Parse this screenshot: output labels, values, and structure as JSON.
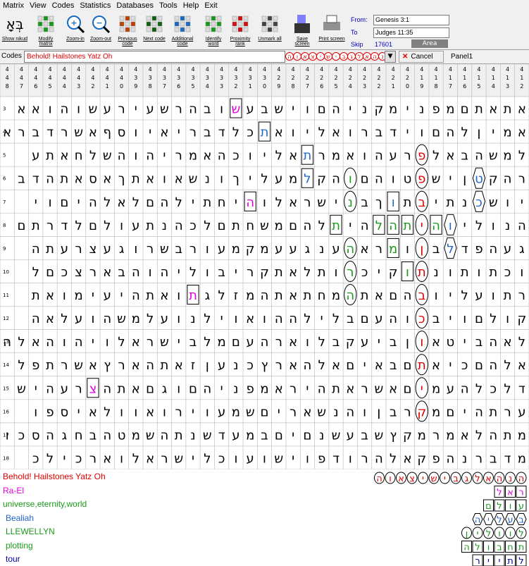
{
  "menu": [
    "Matrix",
    "View",
    "Codes",
    "Statistics",
    "Databases",
    "Tools",
    "Help",
    "Exit"
  ],
  "toolbar": [
    {
      "name": "show-nikud",
      "label": "Show nikud",
      "icon": "nikud-icon"
    },
    {
      "name": "modify-matrix",
      "label": "Modify matrix",
      "icon": "matrix-icon"
    },
    {
      "name": "zoom-in",
      "label": "Zoom-in",
      "icon": "zoom-in-icon"
    },
    {
      "name": "zoom-out",
      "label": "Zoom-out",
      "icon": "zoom-out-icon"
    },
    {
      "name": "previous-code",
      "label": "Previous code",
      "icon": "previous-icon"
    },
    {
      "name": "next-code",
      "label": "Next code",
      "icon": "next-icon"
    },
    {
      "name": "additional-code",
      "label": "Additional code",
      "icon": "additional-icon"
    },
    {
      "name": "identify-word",
      "label": "Identify word",
      "icon": "identify-icon"
    },
    {
      "name": "proximity-rank",
      "label": "Proximity rank",
      "icon": "proximity-icon"
    },
    {
      "name": "unmark-all",
      "label": "Unmark all",
      "icon": "unmark-icon"
    },
    {
      "name": "save-screen",
      "label": "Save screen",
      "icon": "save-icon"
    },
    {
      "name": "print-screen",
      "label": "Print screen",
      "icon": "print-icon"
    }
  ],
  "range": {
    "from_label": "From:",
    "from": "Genesis 3:1",
    "to_label": "To",
    "to": "Judges 11:35"
  },
  "skip": {
    "label": "Skip",
    "value": "17601"
  },
  "area_label": "Area",
  "codes": {
    "label": "Codes :",
    "value": "Behold! Hailstones Yatz Oh",
    "hebrew": "הנהאלגבישיצאוה",
    "cancel": "Cancel",
    "panel": "Panel1"
  },
  "column_numbers": [
    "448",
    "447",
    "446",
    "445",
    "444",
    "443",
    "442",
    "441",
    "440",
    "439",
    "438",
    "437",
    "436",
    "435",
    "434",
    "433",
    "432",
    "431",
    "430",
    "429",
    "428",
    "427",
    "426",
    "425",
    "424",
    "423",
    "422",
    "421",
    "420",
    "419",
    "418",
    "417",
    "416",
    "415",
    "414",
    "413",
    "412"
  ],
  "row_numbers": [
    "3",
    "4",
    "5",
    "6",
    "7",
    "8",
    "9",
    "10",
    "11",
    "12",
    "13",
    "14",
    "15",
    "16",
    "17",
    "18"
  ],
  "matrix": [
    "אתאתםמפנימקניהםוישבעשובהרשעירעשוהואא",
    "אמיןלהםוידברואליואתכלדבריאיוסףאשרדברא",
    "למשהבאלפרעהואמרתאליוכהאמריהוהשלחאתע",
    "רהקטןישפטוהםוהקלמעליךונשאואתךאסאתהדב",
    "יושכנתיבתוךבנישראלוהיחתילהםלאלהיםוי",
    "הנוליוהיתהלהיתלהםמשחתםלכהנתעולםלדרתם",
    "געהפדלבןומראהענגעעמקמעורבשרוגעצרעתה",
    "וכתותונתוקיכרותלאתקריבוליהוהבארצכםל",
    "רתועליובהםאתהמחתאתהמזלגתואתהיעימואת",
    "קולםויבכוהעםבלילההואוילנועלמשהועלאה",
    "לאהביטאוןביעקבלוארהעםמלבישראלויהוהאלה",
    "אלהםכיאתםבאיםאלהארץכנעןזאתהארץאשרתפל",
    "דלכלהעמיםאשראתהיראמפניהםוגםאתהצרעהיש",
    "ערתהיםמקרבןוהנשאריםשמעוירואוולאיספו",
    "מתהלאמרמקץשבעשנםיםבמעדשנתהשמטהבחגהסכות",
    "מדברנהפקאלהרודפוישועוכלישראלוארכילכ"
  ],
  "marks": [
    {
      "row": 0,
      "col": 16,
      "color": "#e000e0",
      "shape": "box"
    },
    {
      "row": 1,
      "col": 18,
      "color": "#2266cc",
      "shape": "box"
    },
    {
      "row": 2,
      "col": 21,
      "color": "#2266cc",
      "shape": "box"
    },
    {
      "row": 2,
      "col": 29,
      "color": "#e00000",
      "shape": "oval"
    },
    {
      "row": 3,
      "col": 21,
      "color": "#2266cc",
      "shape": "box"
    },
    {
      "row": 3,
      "col": 24,
      "color": "#1a9a1a",
      "shape": "oval"
    },
    {
      "row": 3,
      "col": 29,
      "color": "#e00000",
      "shape": "oval"
    },
    {
      "row": 3,
      "col": 33,
      "color": "#2266cc",
      "shape": "hex"
    },
    {
      "row": 4,
      "col": 17,
      "color": "#e000e0",
      "shape": "box"
    },
    {
      "row": 4,
      "col": 24,
      "color": "#1a9a1a",
      "shape": "oval"
    },
    {
      "row": 4,
      "col": 27,
      "color": "#2266cc",
      "shape": "box"
    },
    {
      "row": 4,
      "col": 29,
      "color": "#e00000",
      "shape": "oval"
    },
    {
      "row": 4,
      "col": 33,
      "color": "#2266cc",
      "shape": "hex"
    },
    {
      "row": 5,
      "col": 23,
      "color": "#1a9a1a",
      "shape": "box"
    },
    {
      "row": 5,
      "col": 26,
      "color": "#1a9a1a",
      "shape": "box"
    },
    {
      "row": 5,
      "col": 27,
      "color": "#1a9a1a",
      "shape": "box"
    },
    {
      "row": 5,
      "col": 28,
      "color": "#1a9a1a",
      "shape": "box"
    },
    {
      "row": 5,
      "col": 29,
      "color": "#e00000",
      "shape": "oval"
    },
    {
      "row": 5,
      "col": 30,
      "color": "#1a9a1a",
      "shape": "box"
    },
    {
      "row": 5,
      "col": 31,
      "color": "#2266cc",
      "shape": "hex"
    },
    {
      "row": 6,
      "col": 24,
      "color": "#1a9a1a",
      "shape": "oval"
    },
    {
      "row": 6,
      "col": 27,
      "color": "#1a9a1a",
      "shape": "box"
    },
    {
      "row": 6,
      "col": 29,
      "color": "#e00000",
      "shape": "oval"
    },
    {
      "row": 6,
      "col": 31,
      "color": "#2266cc",
      "shape": "hex"
    },
    {
      "row": 7,
      "col": 24,
      "color": "#1a9a1a",
      "shape": "oval"
    },
    {
      "row": 7,
      "col": 28,
      "color": "#1a9a1a",
      "shape": "box"
    },
    {
      "row": 7,
      "col": 29,
      "color": "#e00000",
      "shape": "oval"
    },
    {
      "row": 8,
      "col": 13,
      "color": "#e000e0",
      "shape": "box"
    },
    {
      "row": 8,
      "col": 24,
      "color": "#1a9a1a",
      "shape": "oval"
    },
    {
      "row": 8,
      "col": 29,
      "color": "#e00000",
      "shape": "oval"
    },
    {
      "row": 9,
      "col": 29,
      "color": "#e00000",
      "shape": "oval"
    },
    {
      "row": 10,
      "col": 29,
      "color": "#e00000",
      "shape": "oval"
    },
    {
      "row": 11,
      "col": 29,
      "color": "#e00000",
      "shape": "oval"
    },
    {
      "row": 12,
      "col": 6,
      "color": "#e000e0",
      "shape": "box"
    },
    {
      "row": 12,
      "col": 29,
      "color": "#e00000",
      "shape": "oval"
    },
    {
      "row": 13,
      "col": 29,
      "color": "#e00000",
      "shape": "oval"
    }
  ],
  "findings": [
    {
      "text": "Behold! Hailstones Yatz Oh",
      "color": "#e00000",
      "hebrew": "הנהאלגבישיצאוה",
      "style": "oval"
    },
    {
      "text": "Ra-El",
      "color": "#e000e0",
      "hebrew": "ראל",
      "style": "box"
    },
    {
      "text": "universe,eternity,world",
      "color": "#1a9a1a",
      "hebrew": "עולם",
      "style": "box"
    },
    {
      "text": "Bealiah",
      "color": "#2266cc",
      "hebrew": "בעליה",
      "style": "hex"
    },
    {
      "text": "LLEWELLYN",
      "color": "#1a9a1a",
      "hebrew": "לוולין",
      "style": "oval"
    },
    {
      "text": "plotting",
      "color": "#1a9a1a",
      "hebrew": "תחבולה",
      "style": "box"
    },
    {
      "text": "tour",
      "color": "#0000a0",
      "hebrew": "לתייר",
      "style": "box"
    }
  ]
}
